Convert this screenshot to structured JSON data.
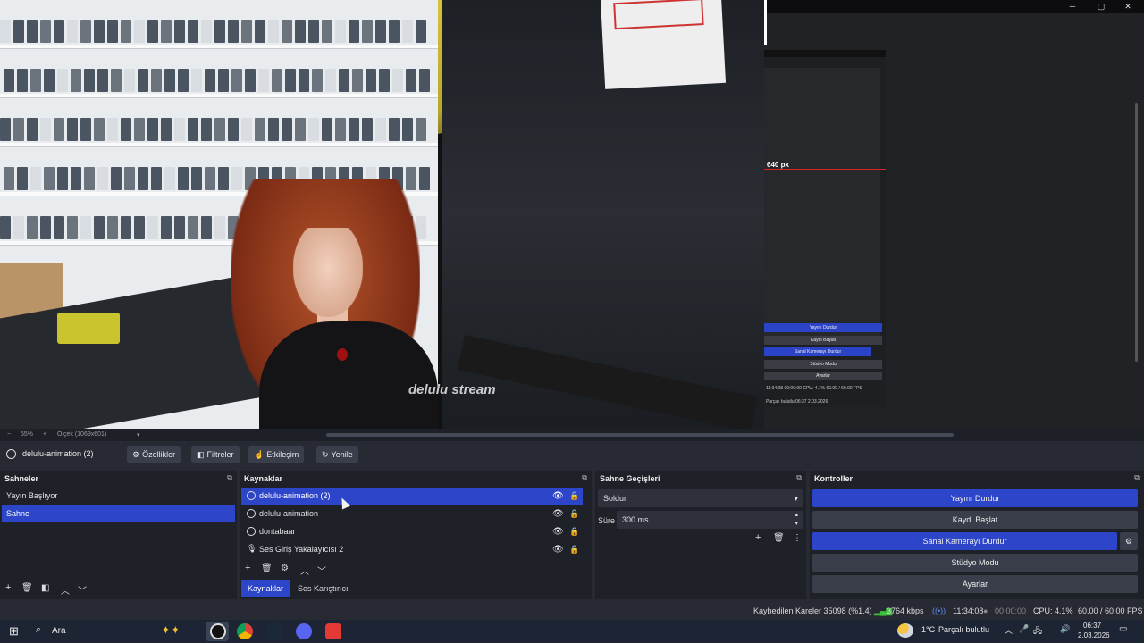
{
  "preview": {
    "watermark": "delulu stream",
    "overlay_label": "640 px"
  },
  "window_controls": {
    "minimize": "─",
    "maximize": "▢",
    "close": "✕"
  },
  "mini_window": {
    "buttons": [
      "Yayını Durdur",
      "Kaydı Başlat",
      "Sanal Kamerayı Durdur",
      "Stüdyo Modu",
      "Ayarlar"
    ],
    "status": "11:34:08   00:00:00   CPU: 4.1%   60.00 / 60.00 FPS",
    "taskbar": "Parçalı bulutlu    06:37  2.03.2026"
  },
  "zoombar": {
    "minus": "−",
    "zoom": "55%",
    "plus": "+",
    "scale": "Ölçek (1069x601)",
    "dropdown": "▾"
  },
  "toolbar": {
    "source_name": "delulu-animation (2)",
    "properties": "Özellikler",
    "filters": "Filtreler",
    "interact": "Etkileşim",
    "refresh": "Yenile"
  },
  "scenes": {
    "title": "Sahneler",
    "items": [
      "Yayın Başlıyor",
      "Sahne"
    ],
    "selected": 1
  },
  "sources": {
    "title": "Kaynaklar",
    "items": [
      {
        "label": "delulu-animation (2)",
        "icon": "browser-icon"
      },
      {
        "label": "delulu-animation",
        "icon": "browser-icon"
      },
      {
        "label": "dontabaar",
        "icon": "browser-icon"
      },
      {
        "label": "Ses Giriş Yakalayıcısı 2",
        "icon": "microphone-icon"
      }
    ],
    "selected": 0,
    "tabs": [
      "Kaynaklar",
      "Ses Karıştırıcı"
    ]
  },
  "transitions": {
    "title": "Sahne Geçişleri",
    "selected": "Soldur",
    "duration_label": "Süre",
    "duration_value": "300 ms"
  },
  "controls": {
    "title": "Kontroller",
    "stop_stream": "Yayını Durdur",
    "start_record": "Kaydı Başlat",
    "stop_virtualcam": "Sanal Kamerayı Durdur",
    "studio_mode": "Stüdyo Modu",
    "settings": "Ayarlar"
  },
  "status": {
    "dropped": "Kaybedilen Kareler 35098 (%1.4)",
    "bitrate": "3764 kbps",
    "stream_time": "11:34:08",
    "record_time": "00:00:00",
    "cpu": "CPU: 4.1%",
    "fps": "60.00 / 60.00 FPS"
  },
  "taskbar": {
    "search": "Ara",
    "temperature": "-1°C",
    "weather": "Parçalı bulutlu",
    "time": "06:37",
    "date": "2.03.2026"
  },
  "colors": {
    "accent": "#2d46c9",
    "panel": "#1f2129",
    "background": "#272a33"
  }
}
